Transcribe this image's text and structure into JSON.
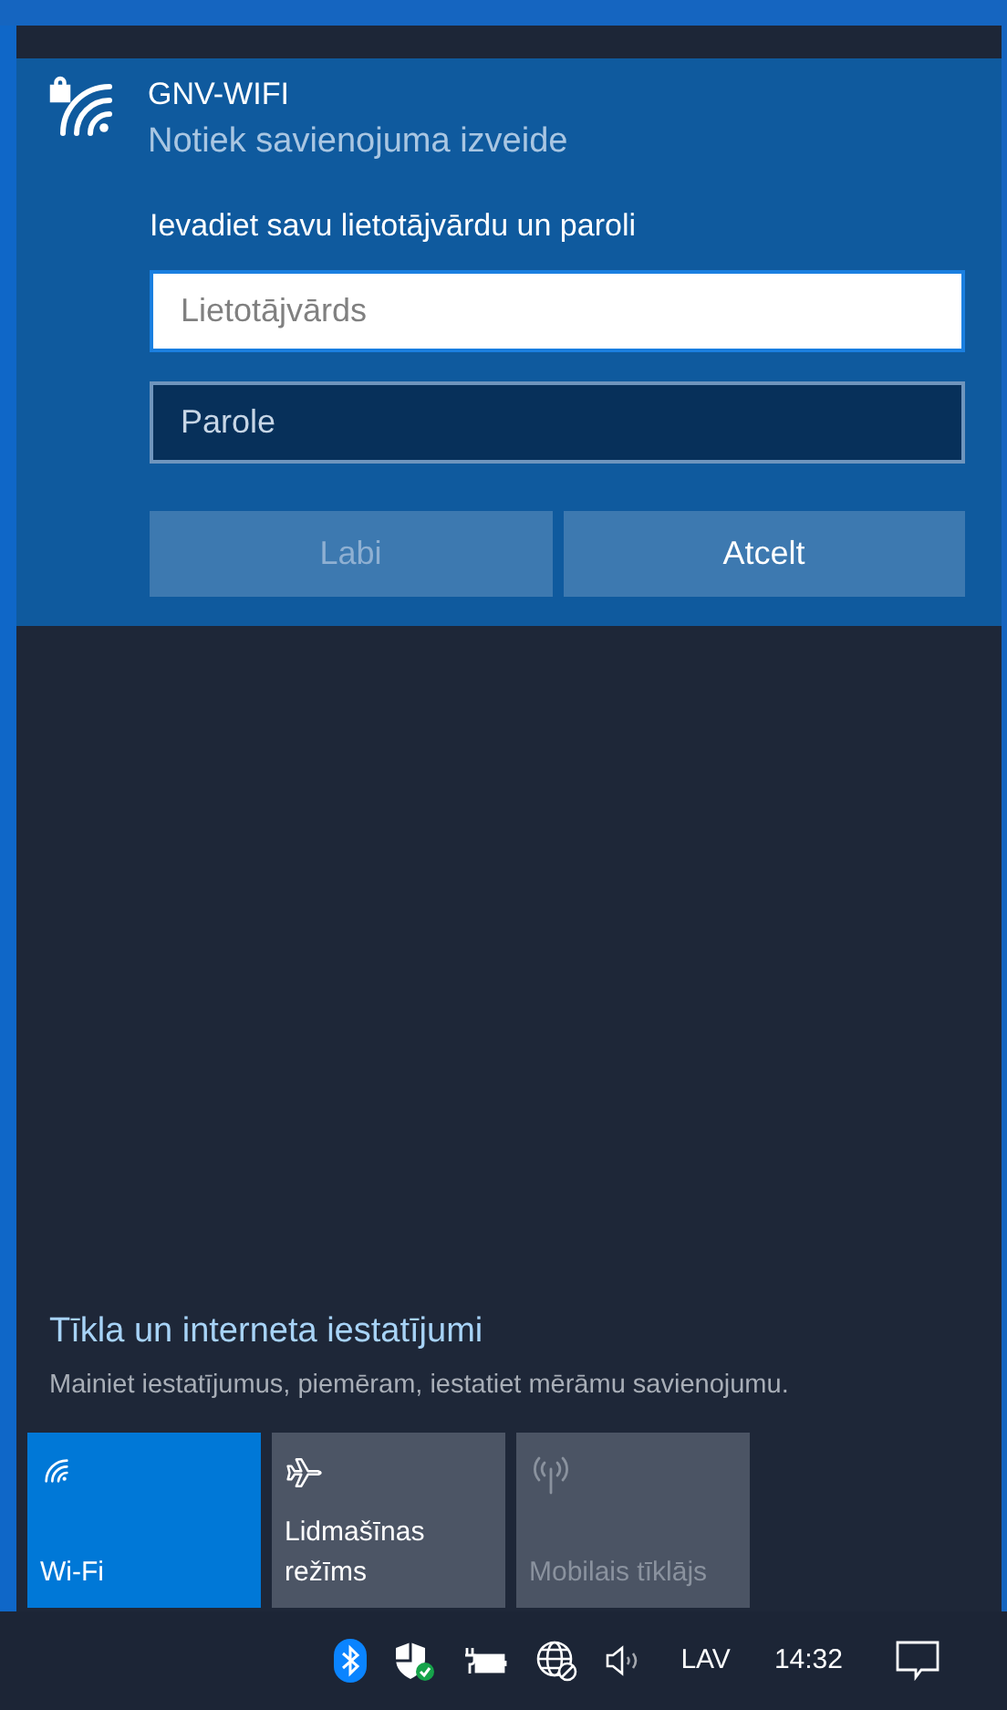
{
  "network": {
    "name": "GNV-WIFI",
    "status": "Notiek savienojuma izveide",
    "prompt": "Ievadiet savu lietotājvārdu un paroli",
    "username": {
      "placeholder": "Lietotājvārds",
      "focused": true
    },
    "password": {
      "placeholder": "Parole",
      "focused": false
    },
    "buttons": [
      {
        "label": "Labi",
        "disabled": true
      },
      {
        "label": "Atcelt",
        "disabled": false
      }
    ]
  },
  "settings": {
    "title": "Tīkla un interneta iestatījumi",
    "description": "Mainiet iestatījumus, piemēram, iestatiet mērāmu savienojumu."
  },
  "quick_actions": [
    {
      "kind": "wifi",
      "label": "Wi-Fi",
      "on": true,
      "disabled": false
    },
    {
      "kind": "airplane",
      "label": "Lidmašīnas režīms",
      "on": false,
      "disabled": false
    },
    {
      "kind": "cellular",
      "label": "Mobilais tīklājs",
      "on": false,
      "disabled": true
    }
  ],
  "taskbar": {
    "language": "LAV",
    "time": "14:32"
  }
}
